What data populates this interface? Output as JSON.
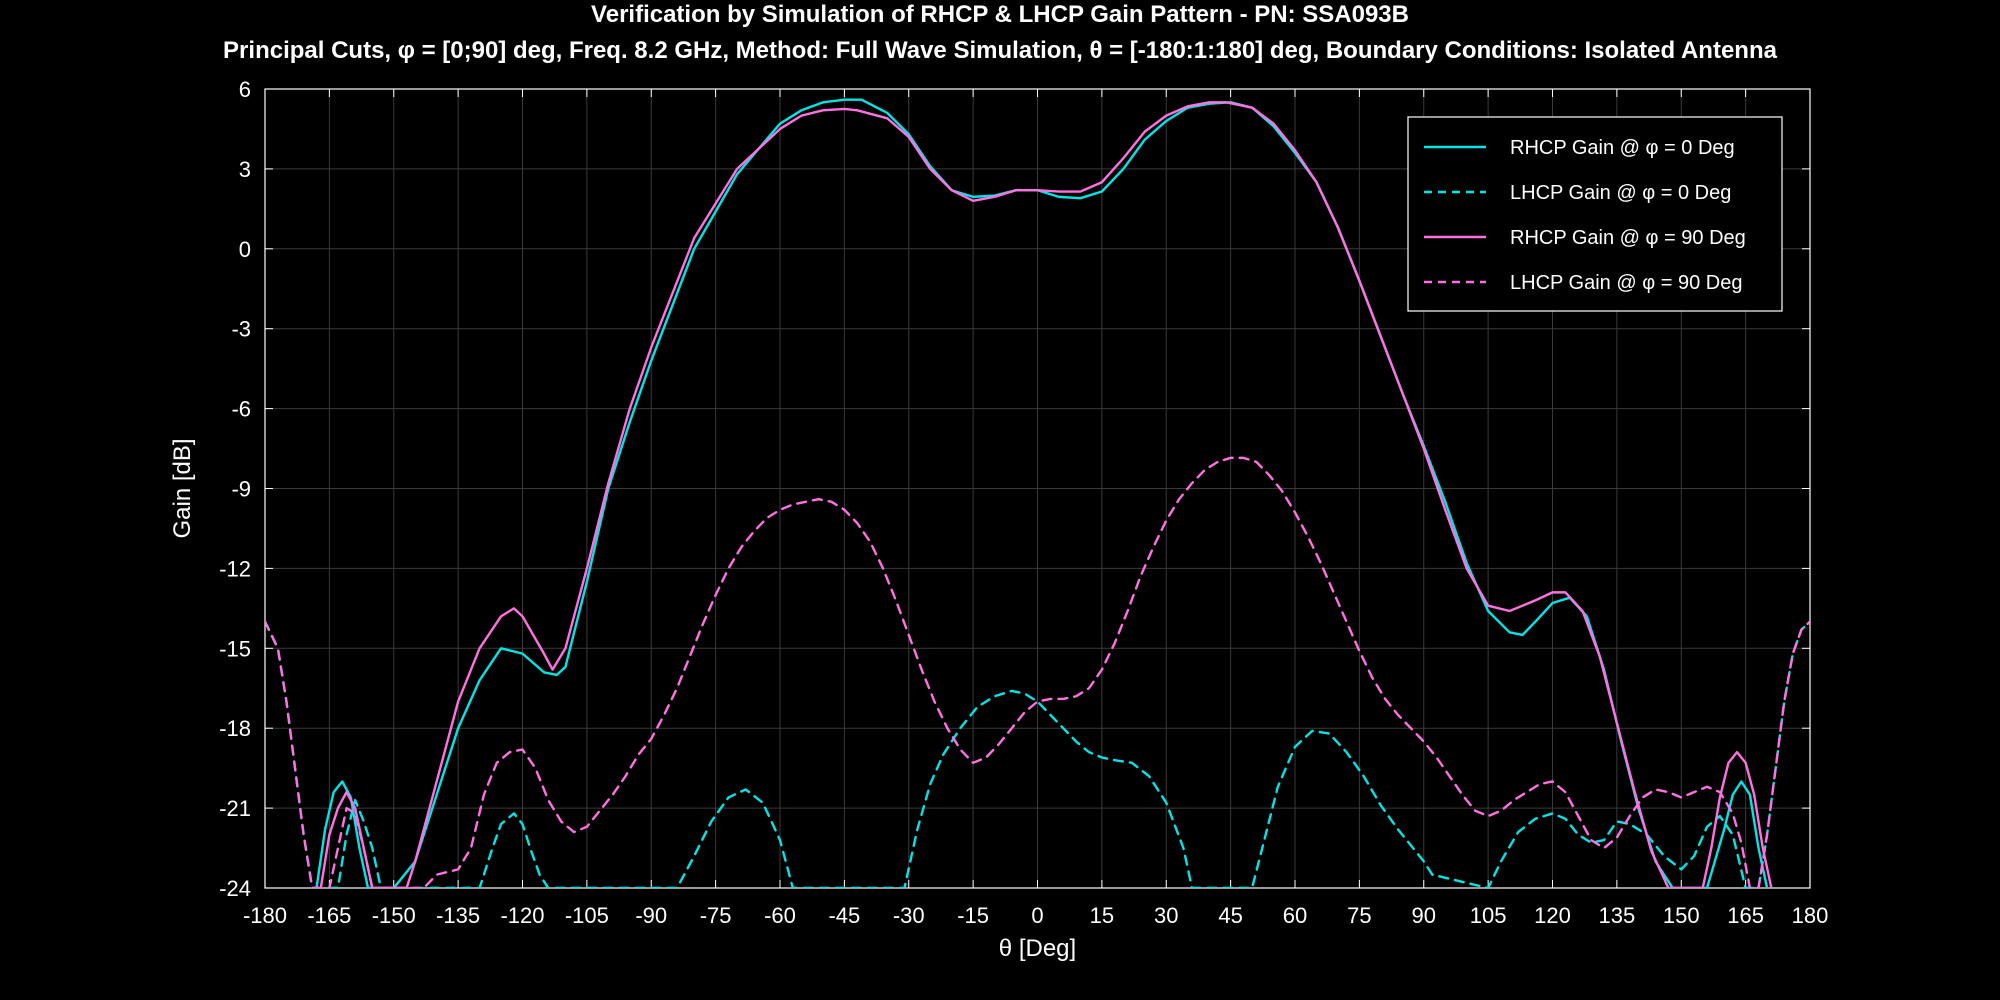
{
  "chart_data": {
    "type": "line",
    "title": "Verification by Simulation of RHCP & LHCP Gain Pattern - PN: SSA093B",
    "subtitle": "Principal Cuts, φ = [0;90] deg, Freq. 8.2 GHz, Method: Full Wave Simulation, θ = [-180:1:180] deg, Boundary Conditions: Isolated Antenna",
    "xlabel": "θ [Deg]",
    "ylabel": "Gain [dB]",
    "xlim": [
      -180,
      180
    ],
    "ylim": [
      -24,
      6
    ],
    "xticks": [
      -180,
      -165,
      -150,
      -135,
      -120,
      -105,
      -90,
      -75,
      -60,
      -45,
      -30,
      -15,
      0,
      15,
      30,
      45,
      60,
      75,
      90,
      105,
      120,
      135,
      150,
      165,
      180
    ],
    "yticks": [
      6,
      3,
      0,
      -3,
      -6,
      -9,
      -12,
      -15,
      -18,
      -21,
      -24
    ],
    "grid": true,
    "legend_position": "top-right",
    "background": "#000000",
    "series": [
      {
        "name": "RHCP Gain @ φ = 0 Deg",
        "color": "#00e5e5",
        "dash": "solid",
        "x": [
          -168,
          -166,
          -164,
          -162,
          -160,
          -158,
          -156,
          -150,
          -145,
          -140,
          -135,
          -130,
          -125,
          -120,
          -115,
          -112,
          -110,
          -105,
          -100,
          -95,
          -90,
          -80,
          -70,
          -60,
          -55,
          -50,
          -45,
          -41,
          -35,
          -30,
          -25,
          -20,
          -15,
          -10,
          -5,
          0,
          5,
          10,
          15,
          20,
          25,
          30,
          35,
          40,
          45,
          50,
          55,
          60,
          65,
          70,
          75,
          80,
          85,
          90,
          95,
          100,
          105,
          110,
          113,
          116,
          120,
          124,
          128,
          132,
          136,
          140,
          144,
          148,
          152,
          156,
          160,
          162,
          164,
          166,
          168,
          170
        ],
        "y": [
          -24,
          -21.8,
          -20.4,
          -20,
          -20.6,
          -22.5,
          -24,
          -24,
          -23,
          -20.5,
          -18,
          -16.2,
          -15,
          -15.2,
          -15.9,
          -16,
          -15.7,
          -12.5,
          -9,
          -6.5,
          -4.2,
          0,
          2.8,
          4.7,
          5.2,
          5.5,
          5.6,
          5.6,
          5.1,
          4.3,
          3.1,
          2.2,
          1.95,
          2,
          2.2,
          2.2,
          1.95,
          1.9,
          2.15,
          3,
          4.1,
          4.8,
          5.3,
          5.45,
          5.5,
          5.3,
          4.6,
          3.6,
          2.5,
          0.8,
          -1.2,
          -3.3,
          -5.4,
          -7.4,
          -9.5,
          -11.8,
          -13.6,
          -14.4,
          -14.5,
          -14,
          -13.3,
          -13.1,
          -13.8,
          -15.8,
          -18.5,
          -21,
          -23,
          -24,
          -24,
          -24,
          -21.8,
          -20.5,
          -20,
          -20.5,
          -22.5,
          -24
        ]
      },
      {
        "name": "LHCP Gain @ φ = 0 Deg",
        "color": "#00e5e5",
        "dash": "dashed",
        "x": [
          -180,
          -177,
          -175,
          -173,
          -171,
          -169,
          -167,
          -165,
          -163,
          -161,
          -159,
          -157,
          -155,
          -153,
          -130,
          -127,
          -125,
          -122,
          -120,
          -118,
          -116,
          -114,
          -84,
          -80,
          -76,
          -72,
          -68,
          -64,
          -60,
          -57,
          -31,
          -28,
          -25,
          -22,
          -18,
          -14,
          -10,
          -6,
          -3,
          0,
          3,
          6,
          9,
          12,
          15,
          18,
          22,
          26,
          30,
          34,
          36,
          40,
          50,
          53,
          56,
          60,
          64,
          68,
          72,
          76,
          80,
          84,
          88,
          90,
          92,
          105,
          108,
          112,
          116,
          120,
          123,
          126,
          129,
          132,
          135,
          138,
          142,
          146,
          150,
          153,
          156,
          159,
          162,
          165,
          168,
          170,
          172,
          174,
          176,
          178,
          180
        ],
        "y": [
          -14,
          -15,
          -17,
          -19.5,
          -22,
          -24,
          -24,
          -24,
          -24,
          -22,
          -20.7,
          -21.5,
          -22.5,
          -24,
          -24,
          -22.5,
          -21.6,
          -21.2,
          -21.6,
          -22.6,
          -23.5,
          -24,
          -24,
          -22.8,
          -21.5,
          -20.6,
          -20.3,
          -20.8,
          -22.2,
          -24,
          -24,
          -21.8,
          -20.1,
          -19,
          -18,
          -17.2,
          -16.8,
          -16.6,
          -16.7,
          -17,
          -17.5,
          -18,
          -18.5,
          -18.9,
          -19.1,
          -19.2,
          -19.3,
          -19.8,
          -20.8,
          -22.5,
          -24,
          -24,
          -24,
          -22.1,
          -20.2,
          -18.7,
          -18.1,
          -18.2,
          -18.9,
          -19.8,
          -20.9,
          -21.8,
          -22.6,
          -23,
          -23.5,
          -24,
          -23,
          -21.9,
          -21.4,
          -21.2,
          -21.4,
          -22,
          -22.3,
          -22.2,
          -21.5,
          -21.6,
          -22,
          -22.8,
          -23.3,
          -22.8,
          -21.7,
          -21.3,
          -22,
          -24,
          -24,
          -22,
          -19.5,
          -17,
          -15.2,
          -14.3,
          -14
        ]
      },
      {
        "name": "RHCP Gain @ φ = 90 Deg",
        "color": "#ff70e0",
        "dash": "solid",
        "x": [
          -167,
          -165,
          -163,
          -161,
          -159,
          -157,
          -155,
          -147,
          -145,
          -140,
          -135,
          -130,
          -125,
          -122,
          -120,
          -115,
          -113,
          -110,
          -105,
          -100,
          -95,
          -90,
          -80,
          -70,
          -60,
          -55,
          -50,
          -45,
          -42,
          -35,
          -30,
          -25,
          -20,
          -15,
          -10,
          -5,
          0,
          5,
          10,
          15,
          20,
          25,
          30,
          35,
          40,
          44,
          50,
          55,
          60,
          65,
          70,
          75,
          80,
          85,
          90,
          95,
          100,
          105,
          110,
          113,
          116,
          120,
          123,
          127,
          131,
          135,
          139,
          143,
          147,
          151,
          155,
          157,
          159,
          161,
          163,
          165,
          167,
          169,
          171
        ],
        "y": [
          -24,
          -22,
          -21,
          -20.4,
          -21,
          -22.5,
          -24,
          -24,
          -23,
          -20,
          -17,
          -15,
          -13.8,
          -13.5,
          -13.8,
          -15.2,
          -15.8,
          -15,
          -12,
          -8.8,
          -6,
          -3.7,
          0.4,
          3,
          4.5,
          5,
          5.2,
          5.25,
          5.2,
          4.9,
          4.2,
          3,
          2.2,
          1.8,
          1.95,
          2.2,
          2.2,
          2.15,
          2.15,
          2.5,
          3.4,
          4.4,
          5,
          5.35,
          5.5,
          5.5,
          5.3,
          4.7,
          3.7,
          2.5,
          0.8,
          -1.2,
          -3.3,
          -5.4,
          -7.5,
          -9.8,
          -12,
          -13.4,
          -13.6,
          -13.4,
          -13.2,
          -12.9,
          -12.9,
          -13.6,
          -15.3,
          -17.8,
          -20.3,
          -22.6,
          -24,
          -24,
          -24,
          -22.5,
          -20.6,
          -19.3,
          -18.9,
          -19.3,
          -20.5,
          -22.5,
          -24
        ]
      },
      {
        "name": "LHCP Gain @ φ = 90 Deg",
        "color": "#ff70e0",
        "dash": "dashed",
        "x": [
          -180,
          -177,
          -175,
          -173,
          -171,
          -169,
          -167,
          -165,
          -163,
          -161,
          -159,
          -157,
          -155,
          -153,
          -143,
          -140,
          -135,
          -132,
          -129,
          -126,
          -123,
          -120,
          -117,
          -114,
          -111,
          -108,
          -105,
          -102,
          -99,
          -96,
          -93,
          -90,
          -87,
          -84,
          -81,
          -78,
          -75,
          -72,
          -69,
          -66,
          -63,
          -60,
          -57,
          -54,
          -51,
          -48,
          -45,
          -42,
          -39,
          -36,
          -33,
          -30,
          -27,
          -24,
          -21,
          -18,
          -15,
          -12,
          -9,
          -6,
          -3,
          0,
          3,
          6,
          9,
          12,
          15,
          18,
          21,
          24,
          27,
          30,
          33,
          36,
          39,
          42,
          45,
          48,
          51,
          54,
          57,
          60,
          63,
          66,
          69,
          72,
          75,
          78,
          81,
          84,
          87,
          90,
          93,
          96,
          99,
          102,
          105,
          108,
          111,
          114,
          117,
          120,
          123,
          126,
          129,
          132,
          135,
          138,
          141,
          144,
          147,
          150,
          153,
          156,
          159,
          162,
          164,
          166,
          168,
          170,
          172,
          174,
          176,
          178,
          180
        ],
        "y": [
          -14,
          -15,
          -17,
          -19.5,
          -22,
          -24,
          -24,
          -24,
          -22.5,
          -21,
          -21.2,
          -22.5,
          -24,
          -24,
          -24,
          -23.5,
          -23.3,
          -22.5,
          -20.5,
          -19.3,
          -18.9,
          -18.8,
          -19.5,
          -20.7,
          -21.5,
          -21.9,
          -21.7,
          -21.1,
          -20.5,
          -19.8,
          -19,
          -18.4,
          -17.5,
          -16.5,
          -15.3,
          -14.1,
          -13,
          -12,
          -11.2,
          -10.6,
          -10.1,
          -9.8,
          -9.6,
          -9.5,
          -9.4,
          -9.5,
          -9.8,
          -10.3,
          -11,
          -12,
          -13.2,
          -14.5,
          -15.8,
          -17,
          -18,
          -18.8,
          -19.3,
          -19.1,
          -18.6,
          -18,
          -17.4,
          -17,
          -16.9,
          -16.9,
          -16.8,
          -16.5,
          -15.8,
          -14.8,
          -13.6,
          -12.3,
          -11.2,
          -10.2,
          -9.4,
          -8.8,
          -8.3,
          -8,
          -7.85,
          -7.85,
          -8,
          -8.5,
          -9.1,
          -9.9,
          -10.8,
          -11.8,
          -12.9,
          -14,
          -15.1,
          -16.1,
          -16.9,
          -17.5,
          -18,
          -18.5,
          -19.1,
          -19.8,
          -20.5,
          -21.1,
          -21.3,
          -21.1,
          -20.7,
          -20.4,
          -20.1,
          -20,
          -20.4,
          -21.3,
          -22.2,
          -22.5,
          -22.1,
          -21.3,
          -20.6,
          -20.3,
          -20.4,
          -20.6,
          -20.4,
          -20.2,
          -20.4,
          -21.2,
          -22.3,
          -24,
          -24,
          -22,
          -19.5,
          -17,
          -15.2,
          -14.3,
          -14
        ]
      }
    ]
  }
}
